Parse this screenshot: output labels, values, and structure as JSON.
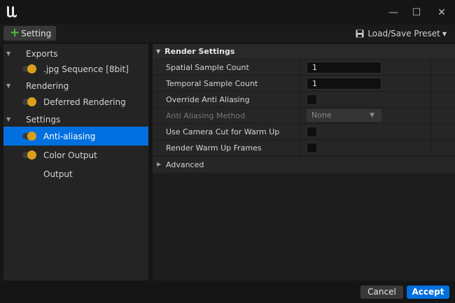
{
  "window": {
    "logo_icon": "unreal-engine-logo-icon",
    "minimize_glyph": "—",
    "maximize_glyph": "☐",
    "close_glyph": "✕"
  },
  "toolbar": {
    "add_setting_label": "Setting",
    "load_save_preset_label": "Load/Save Preset"
  },
  "tree": {
    "items": [
      {
        "type": "category",
        "label": "Exports"
      },
      {
        "type": "setting",
        "label": ".jpg Sequence [8bit]",
        "enabled": true
      },
      {
        "type": "category",
        "label": "Rendering"
      },
      {
        "type": "setting",
        "label": "Deferred Rendering",
        "enabled": true
      },
      {
        "type": "category",
        "label": "Settings"
      },
      {
        "type": "setting",
        "label": "Anti-aliasing",
        "enabled": true,
        "selected": true
      },
      {
        "type": "setting",
        "label": "Color Output",
        "enabled": true
      },
      {
        "type": "setting",
        "label": "Output",
        "enabled": null
      }
    ]
  },
  "details": {
    "section_title": "Render Settings",
    "properties": [
      {
        "label": "Spatial Sample Count",
        "kind": "number",
        "value": "1"
      },
      {
        "label": "Temporal Sample Count",
        "kind": "number",
        "value": "1"
      },
      {
        "label": "Override Anti Aliasing",
        "kind": "checkbox",
        "checked": false
      },
      {
        "label": "Anti Aliasing Method",
        "kind": "dropdown",
        "value": "None",
        "disabled": true
      },
      {
        "label": "Use Camera Cut for Warm Up",
        "kind": "checkbox",
        "checked": false
      },
      {
        "label": "Render Warm Up Frames",
        "kind": "checkbox",
        "checked": false
      }
    ],
    "advanced_label": "Advanced"
  },
  "footer": {
    "cancel_label": "Cancel",
    "accept_label": "Accept"
  },
  "colors": {
    "accent": "#0070e0",
    "toggle_on": "#d8a01a",
    "add_icon": "#4fbc3b"
  }
}
